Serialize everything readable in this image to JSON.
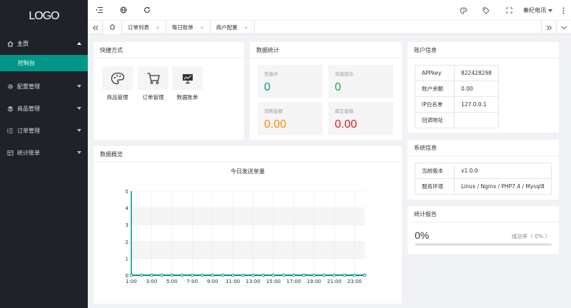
{
  "logo": "LOGO",
  "sidebar": {
    "items": [
      {
        "label": "主页",
        "icon": "home-icon",
        "open": true
      },
      {
        "label": "配置管理",
        "icon": "gear-icon"
      },
      {
        "label": "商品管理",
        "icon": "layers-icon"
      },
      {
        "label": "订单管理",
        "icon": "list-icon"
      },
      {
        "label": "统计账单",
        "icon": "table-icon"
      }
    ],
    "active_sub": "控制台"
  },
  "topbar": {
    "user": "秦纪电讯"
  },
  "tabs": [
    {
      "label": "订单列表"
    },
    {
      "label": "每日账单"
    },
    {
      "label": "商户配置"
    }
  ],
  "shortcuts": {
    "title": "快捷方式",
    "items": [
      {
        "label": "商品管理",
        "icon": "palette-icon"
      },
      {
        "label": "订单管理",
        "icon": "cart-icon"
      },
      {
        "label": "数据账单",
        "icon": "chart-icon"
      }
    ]
  },
  "stats": {
    "title": "数据统计",
    "items": [
      {
        "label": "充值中",
        "value": "0",
        "color": "#009688"
      },
      {
        "label": "充值成功",
        "value": "0",
        "color": "#22a833"
      },
      {
        "label": "消耗金额",
        "value": "0.00",
        "color": "#ff8a00"
      },
      {
        "label": "成交金额",
        "value": "0.00",
        "color": "#e01e1e"
      }
    ]
  },
  "account": {
    "title": "账户信息",
    "rows": [
      {
        "k": "APPkey",
        "v": "822428298"
      },
      {
        "k": "账户余额",
        "v": "0.00"
      },
      {
        "k": "IP白名单",
        "v": "127.0.0.1"
      },
      {
        "k": "回调地址",
        "v": ""
      }
    ]
  },
  "system": {
    "title": "系统信息",
    "rows": [
      {
        "k": "当前版本",
        "v": "v1.0.0"
      },
      {
        "k": "服务环境",
        "v": "Linux / Nginx / PHP7.4 / Mysql8"
      }
    ]
  },
  "report": {
    "title": "统计报告",
    "percent_text": "0%",
    "rate_label": "成功率（ 0% ）",
    "progress": 0
  },
  "overview": {
    "title": "数据概览"
  },
  "chart_data": {
    "type": "line",
    "title": "今日发送单量",
    "categories": [
      "1:00",
      "2:00",
      "3:00",
      "4:00",
      "5:00",
      "6:00",
      "7:00",
      "8:00",
      "9:00",
      "10:00",
      "11:00",
      "12:00",
      "13:00",
      "14:00",
      "15:00",
      "16:00",
      "17:00",
      "18:00",
      "19:00",
      "20:00",
      "21:00",
      "22:00",
      "23:00",
      "24:00"
    ],
    "tick_labels": [
      "1:00",
      "3:00",
      "5:00",
      "7:00",
      "9:00",
      "11:00",
      "13:00",
      "15:00",
      "17:00",
      "19:00",
      "21:00",
      "23:00"
    ],
    "series": [
      {
        "values": [
          0,
          0,
          0,
          0,
          0,
          0,
          0,
          0,
          0,
          0,
          0,
          0,
          0,
          0,
          0,
          0,
          0,
          0,
          0,
          0,
          0,
          0,
          0,
          0
        ]
      }
    ],
    "ylim": [
      0,
      5
    ],
    "yticks": [
      0,
      1,
      2,
      3,
      4,
      5
    ],
    "grid": true,
    "color": "#009688"
  }
}
